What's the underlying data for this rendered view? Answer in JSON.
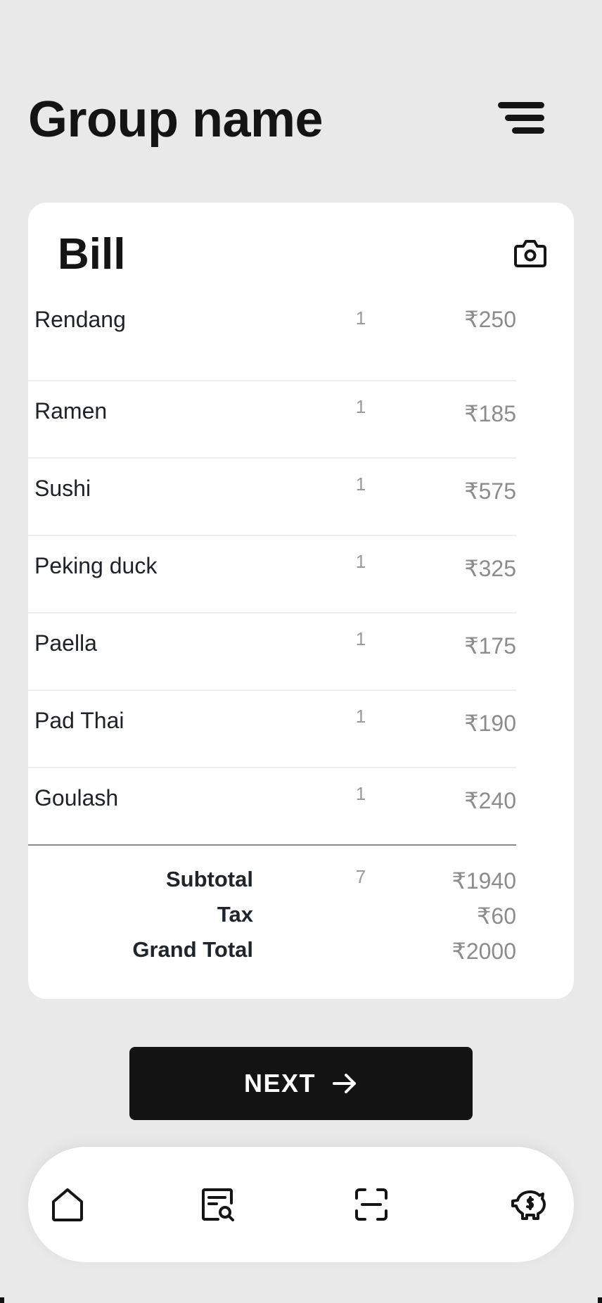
{
  "header": {
    "title": "Group name",
    "menu_icon": "menu-icon"
  },
  "bill": {
    "title": "Bill",
    "camera_icon": "camera-icon",
    "items": [
      {
        "name": "Rendang",
        "qty": "1",
        "price": "₹250"
      },
      {
        "name": "Ramen",
        "qty": "1",
        "price": "₹185"
      },
      {
        "name": "Sushi",
        "qty": "1",
        "price": "₹575"
      },
      {
        "name": "Peking duck",
        "qty": "1",
        "price": "₹325"
      },
      {
        "name": "Paella",
        "qty": "1",
        "price": "₹175"
      },
      {
        "name": "Pad Thai",
        "qty": "1",
        "price": "₹190"
      },
      {
        "name": "Goulash",
        "qty": "1",
        "price": "₹240"
      }
    ],
    "totals": {
      "subtotal_label": "Subtotal",
      "subtotal_qty": "7",
      "subtotal_value": "₹1940",
      "tax_label": "Tax",
      "tax_value": "₹60",
      "grand_total_label": "Grand Total",
      "grand_total_value": "₹2000"
    }
  },
  "next_button": {
    "label": "NEXT",
    "icon": "arrow-right-icon"
  },
  "bottom_nav": {
    "items": [
      {
        "icon": "home-icon"
      },
      {
        "icon": "receipt-search-icon"
      },
      {
        "icon": "scan-icon"
      },
      {
        "icon": "piggy-bank-icon"
      }
    ]
  },
  "colors": {
    "background": "#e9e9e9",
    "card": "#ffffff",
    "primary_text": "#141414",
    "muted_text": "#8c8c8c",
    "button": "#131313",
    "button_text": "#ffffff"
  }
}
